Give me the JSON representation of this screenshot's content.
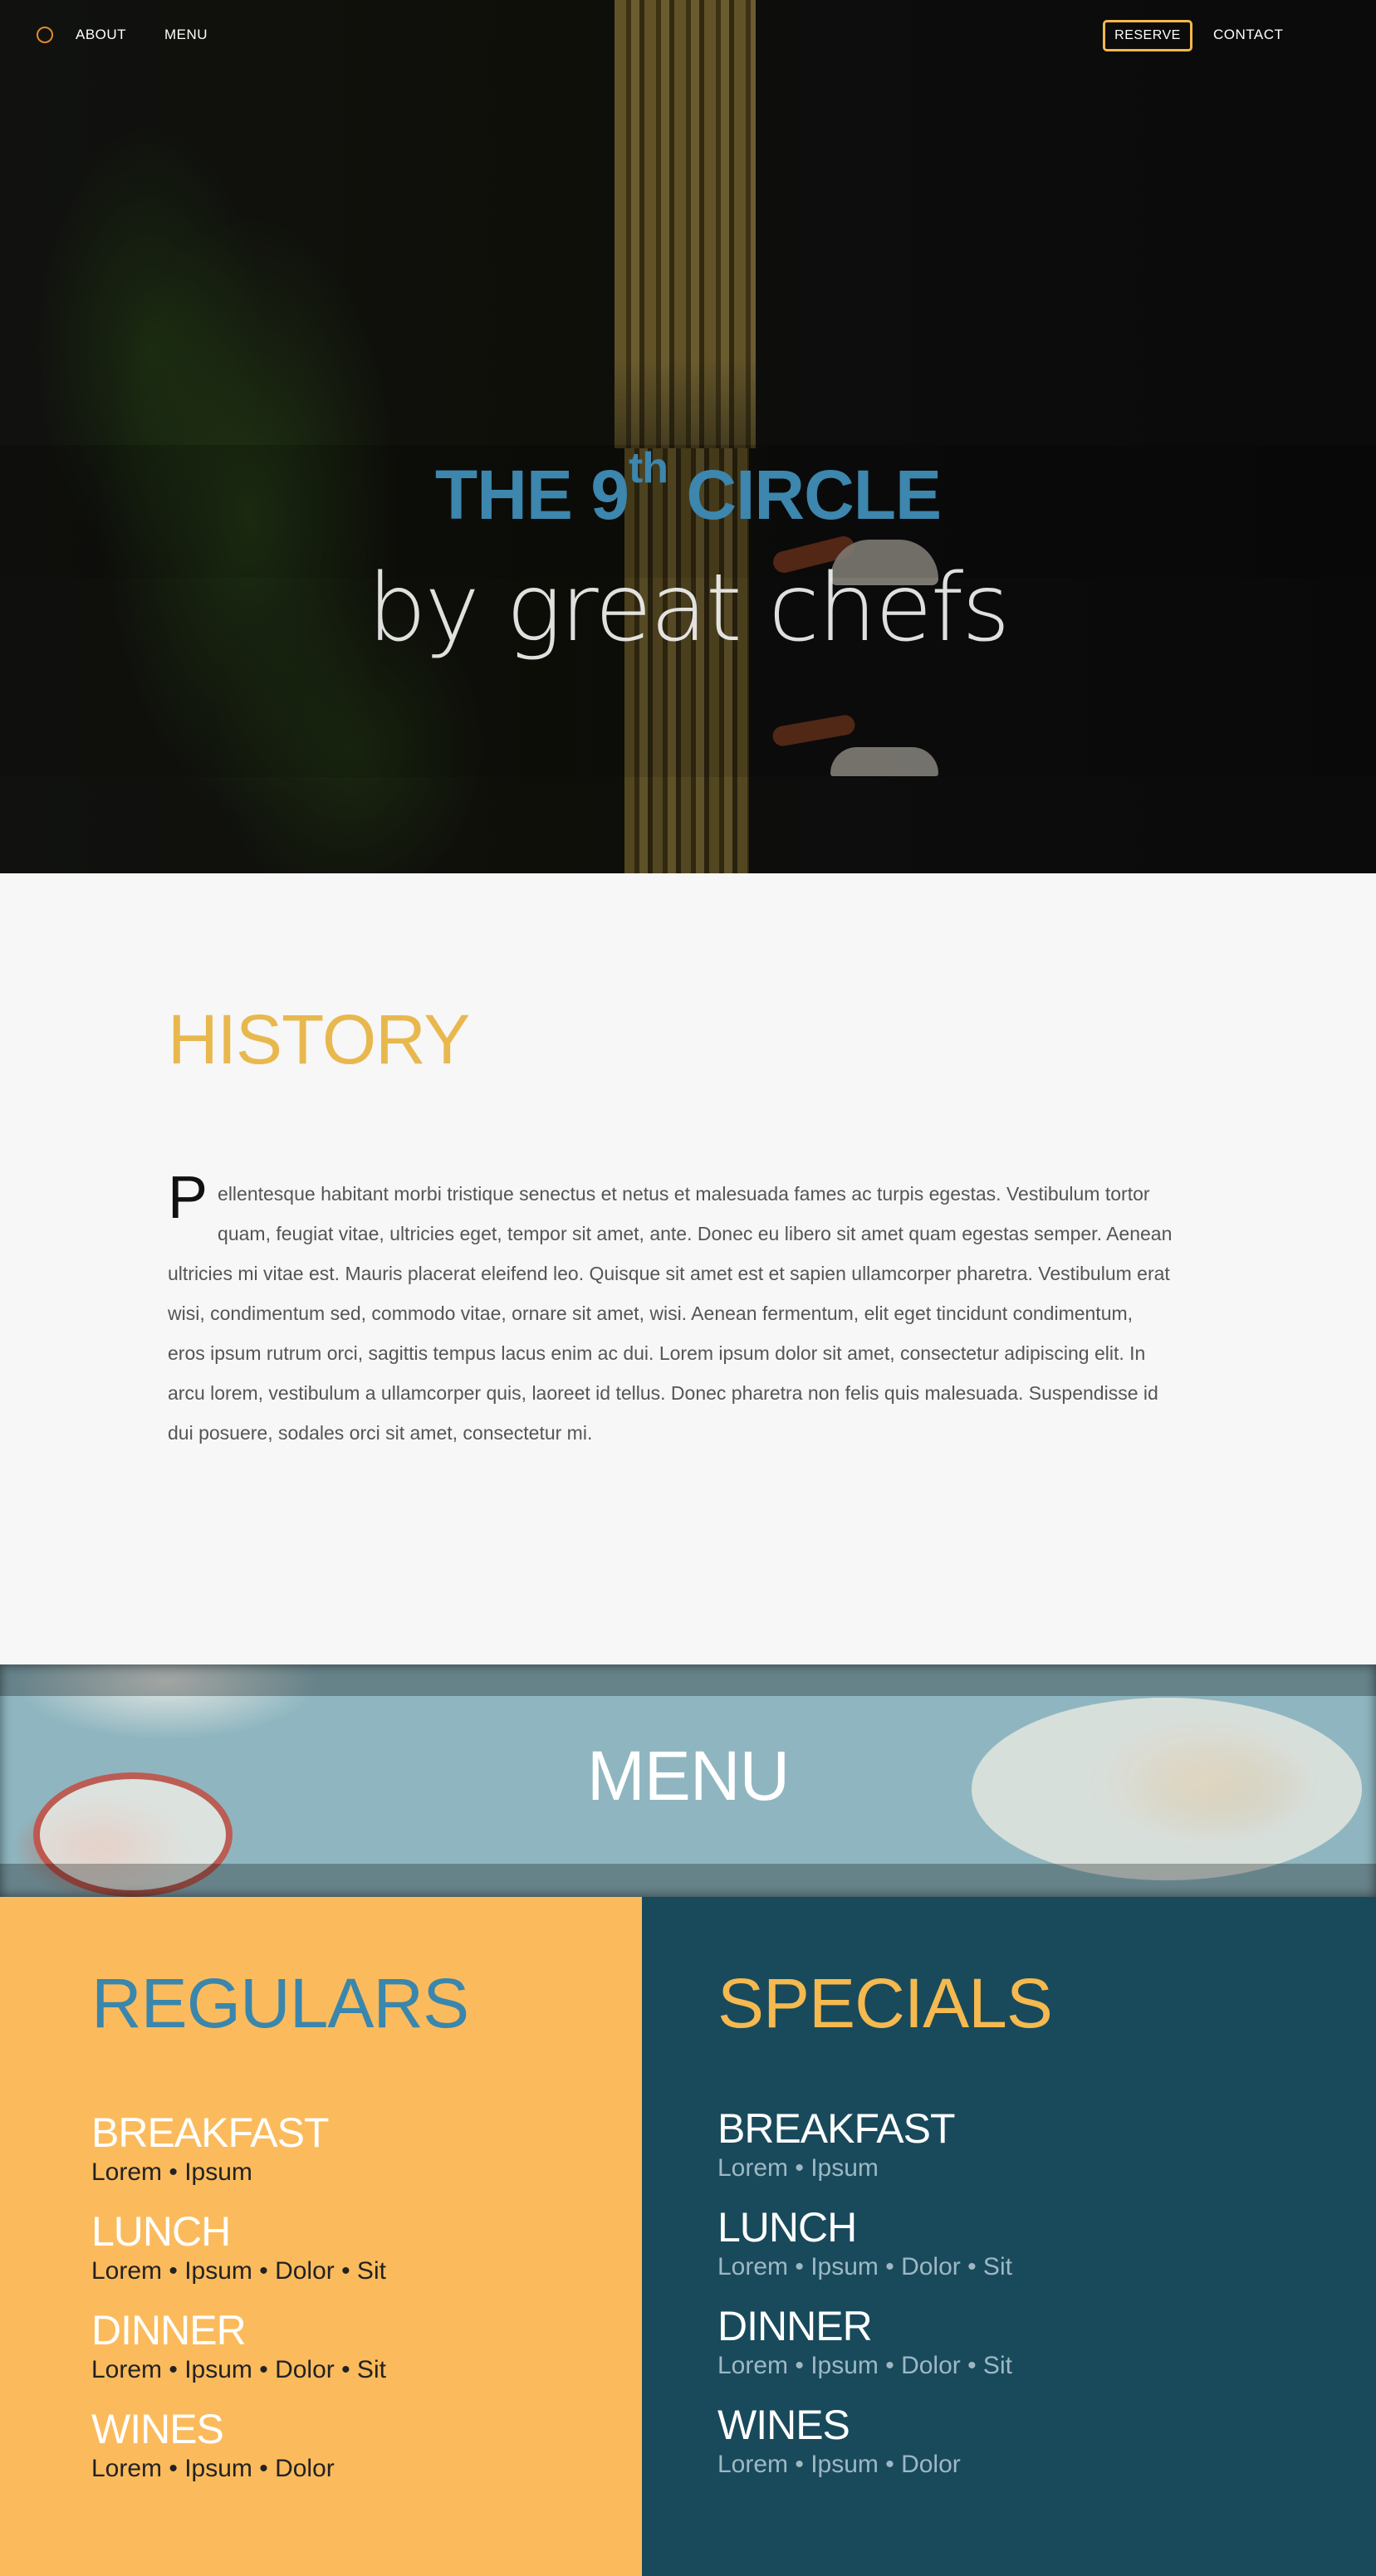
{
  "nav": {
    "about": "ABOUT",
    "menu": "MENU",
    "reserve": "RESERVE",
    "contact": "CONTACT"
  },
  "hero": {
    "title_pre": "THE 9",
    "title_sup": "th",
    "title_post": " CIRCLE",
    "subtitle": "by great chefs"
  },
  "history": {
    "heading": "HISTORY",
    "dropcap": "P",
    "body": "ellentesque habitant morbi tristique senectus et netus et malesuada fames ac turpis egestas. Vestibulum tortor quam, feugiat vitae, ultricies eget, tempor sit amet, ante. Donec eu libero sit amet quam egestas semper. Aenean ultricies mi vitae est. Mauris placerat eleifend leo. Quisque sit amet est et sapien ullamcorper pharetra. Vestibulum erat wisi, condimentum sed, commodo vitae, ornare sit amet, wisi. Aenean fermentum, elit eget tincidunt condimentum, eros ipsum rutrum orci, sagittis tempus lacus enim ac dui. Lorem ipsum dolor sit amet, consectetur adipiscing elit. In arcu lorem, vestibulum a ullamcorper quis, laoreet id tellus. Donec pharetra non felis quis malesuada. Suspendisse id dui posuere, sodales orci sit amet, consectetur mi."
  },
  "menu_banner": {
    "heading": "MENU"
  },
  "regulars": {
    "heading": "REGULARS",
    "items": [
      {
        "name": "BREAKFAST",
        "desc": "Lorem • Ipsum"
      },
      {
        "name": "LUNCH",
        "desc": "Lorem • Ipsum • Dolor • Sit"
      },
      {
        "name": "DINNER",
        "desc": "Lorem • Ipsum • Dolor • Sit"
      },
      {
        "name": "WINES",
        "desc": "Lorem • Ipsum • Dolor"
      }
    ]
  },
  "specials": {
    "heading": "SPECIALS",
    "items": [
      {
        "name": "BREAKFAST",
        "desc": "Lorem • Ipsum"
      },
      {
        "name": "LUNCH",
        "desc": "Lorem • Ipsum • Dolor • Sit"
      },
      {
        "name": "DINNER",
        "desc": "Lorem • Ipsum • Dolor • Sit"
      },
      {
        "name": "WINES",
        "desc": "Lorem • Ipsum • Dolor"
      }
    ]
  },
  "colors": {
    "accent_orange": "#f5b74e",
    "accent_blue": "#3d86ad",
    "regulars_bg": "#fbbb5c",
    "specials_bg": "#184a5c"
  }
}
